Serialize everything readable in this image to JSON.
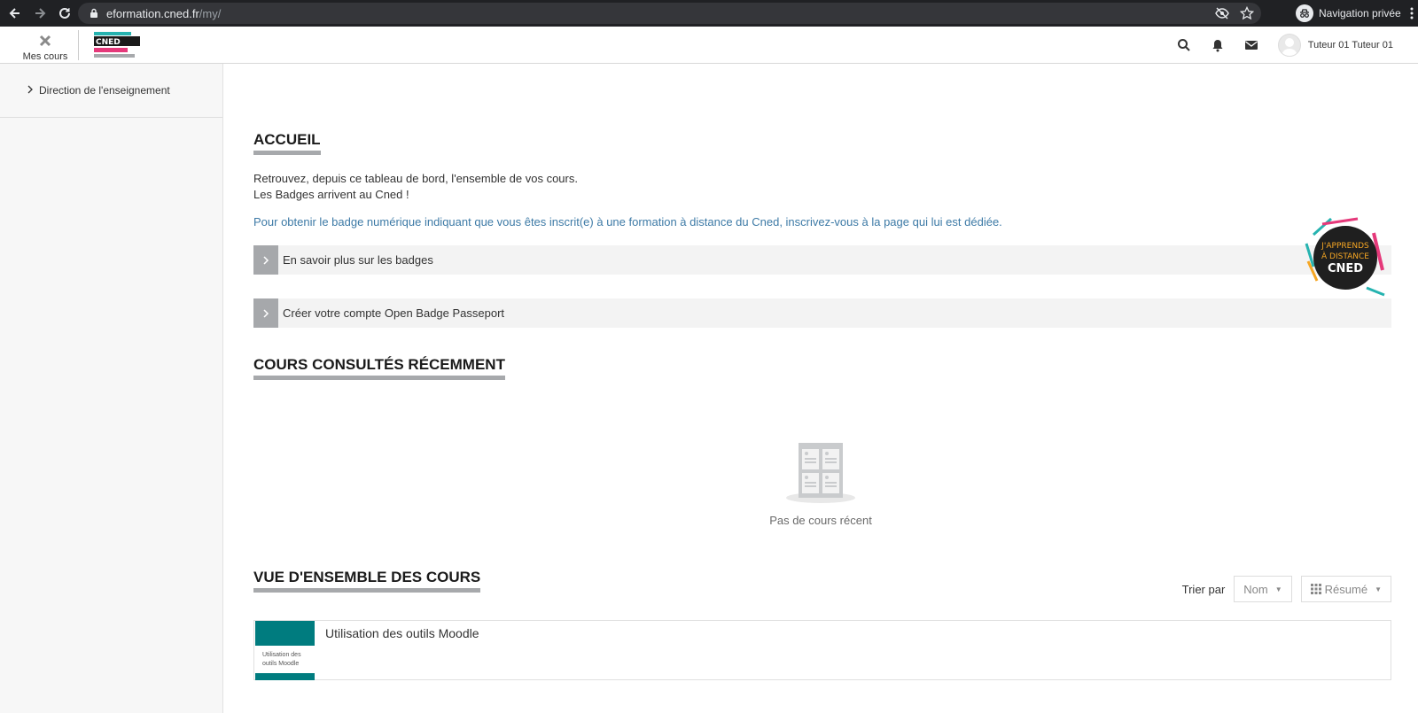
{
  "browser": {
    "url_host": "eformation.cned.fr",
    "url_path": "/my/",
    "private_label": "Navigation privée"
  },
  "header": {
    "mes_cours_label": "Mes cours",
    "logo_text": "CNED",
    "user_name": "Tuteur 01 Tuteur 01"
  },
  "sidebar": {
    "items": [
      {
        "label": "Direction de l'enseignement"
      }
    ]
  },
  "accueil": {
    "title": "ACCUEIL",
    "line1": "Retrouvez, depuis ce tableau de bord, l'ensemble de vos cours.",
    "line2": "Les Badges arrivent au Cned !",
    "link": "Pour obtenir le badge numérique indiquant que vous êtes inscrit(e) à une formation à distance du Cned, inscrivez-vous à la page qui lui est dédiée.",
    "collapsibles": [
      {
        "label": "En savoir plus sur les badges"
      },
      {
        "label": "Créer votre compte Open Badge Passeport"
      }
    ],
    "badge": {
      "line1": "J'APPRENDS",
      "line2": "À DISTANCE",
      "line3": "CNED"
    }
  },
  "recent": {
    "title": "COURS CONSULTÉS RÉCEMMENT",
    "empty_message": "Pas de cours récent"
  },
  "overview": {
    "title": "VUE D'ENSEMBLE DES COURS",
    "sort_label": "Trier par",
    "sort_value": "Nom",
    "view_value": "Résumé",
    "courses": [
      {
        "title": "Utilisation des outils Moodle",
        "thumb_text": "Utilisation des outils Moodle"
      }
    ]
  },
  "colors": {
    "accent_teal": "#007c7f",
    "link_blue": "#3d7aa6",
    "underline_grey": "#a7a9ac",
    "cned_pink": "#e5397a",
    "cned_teal": "#26b3b0"
  }
}
